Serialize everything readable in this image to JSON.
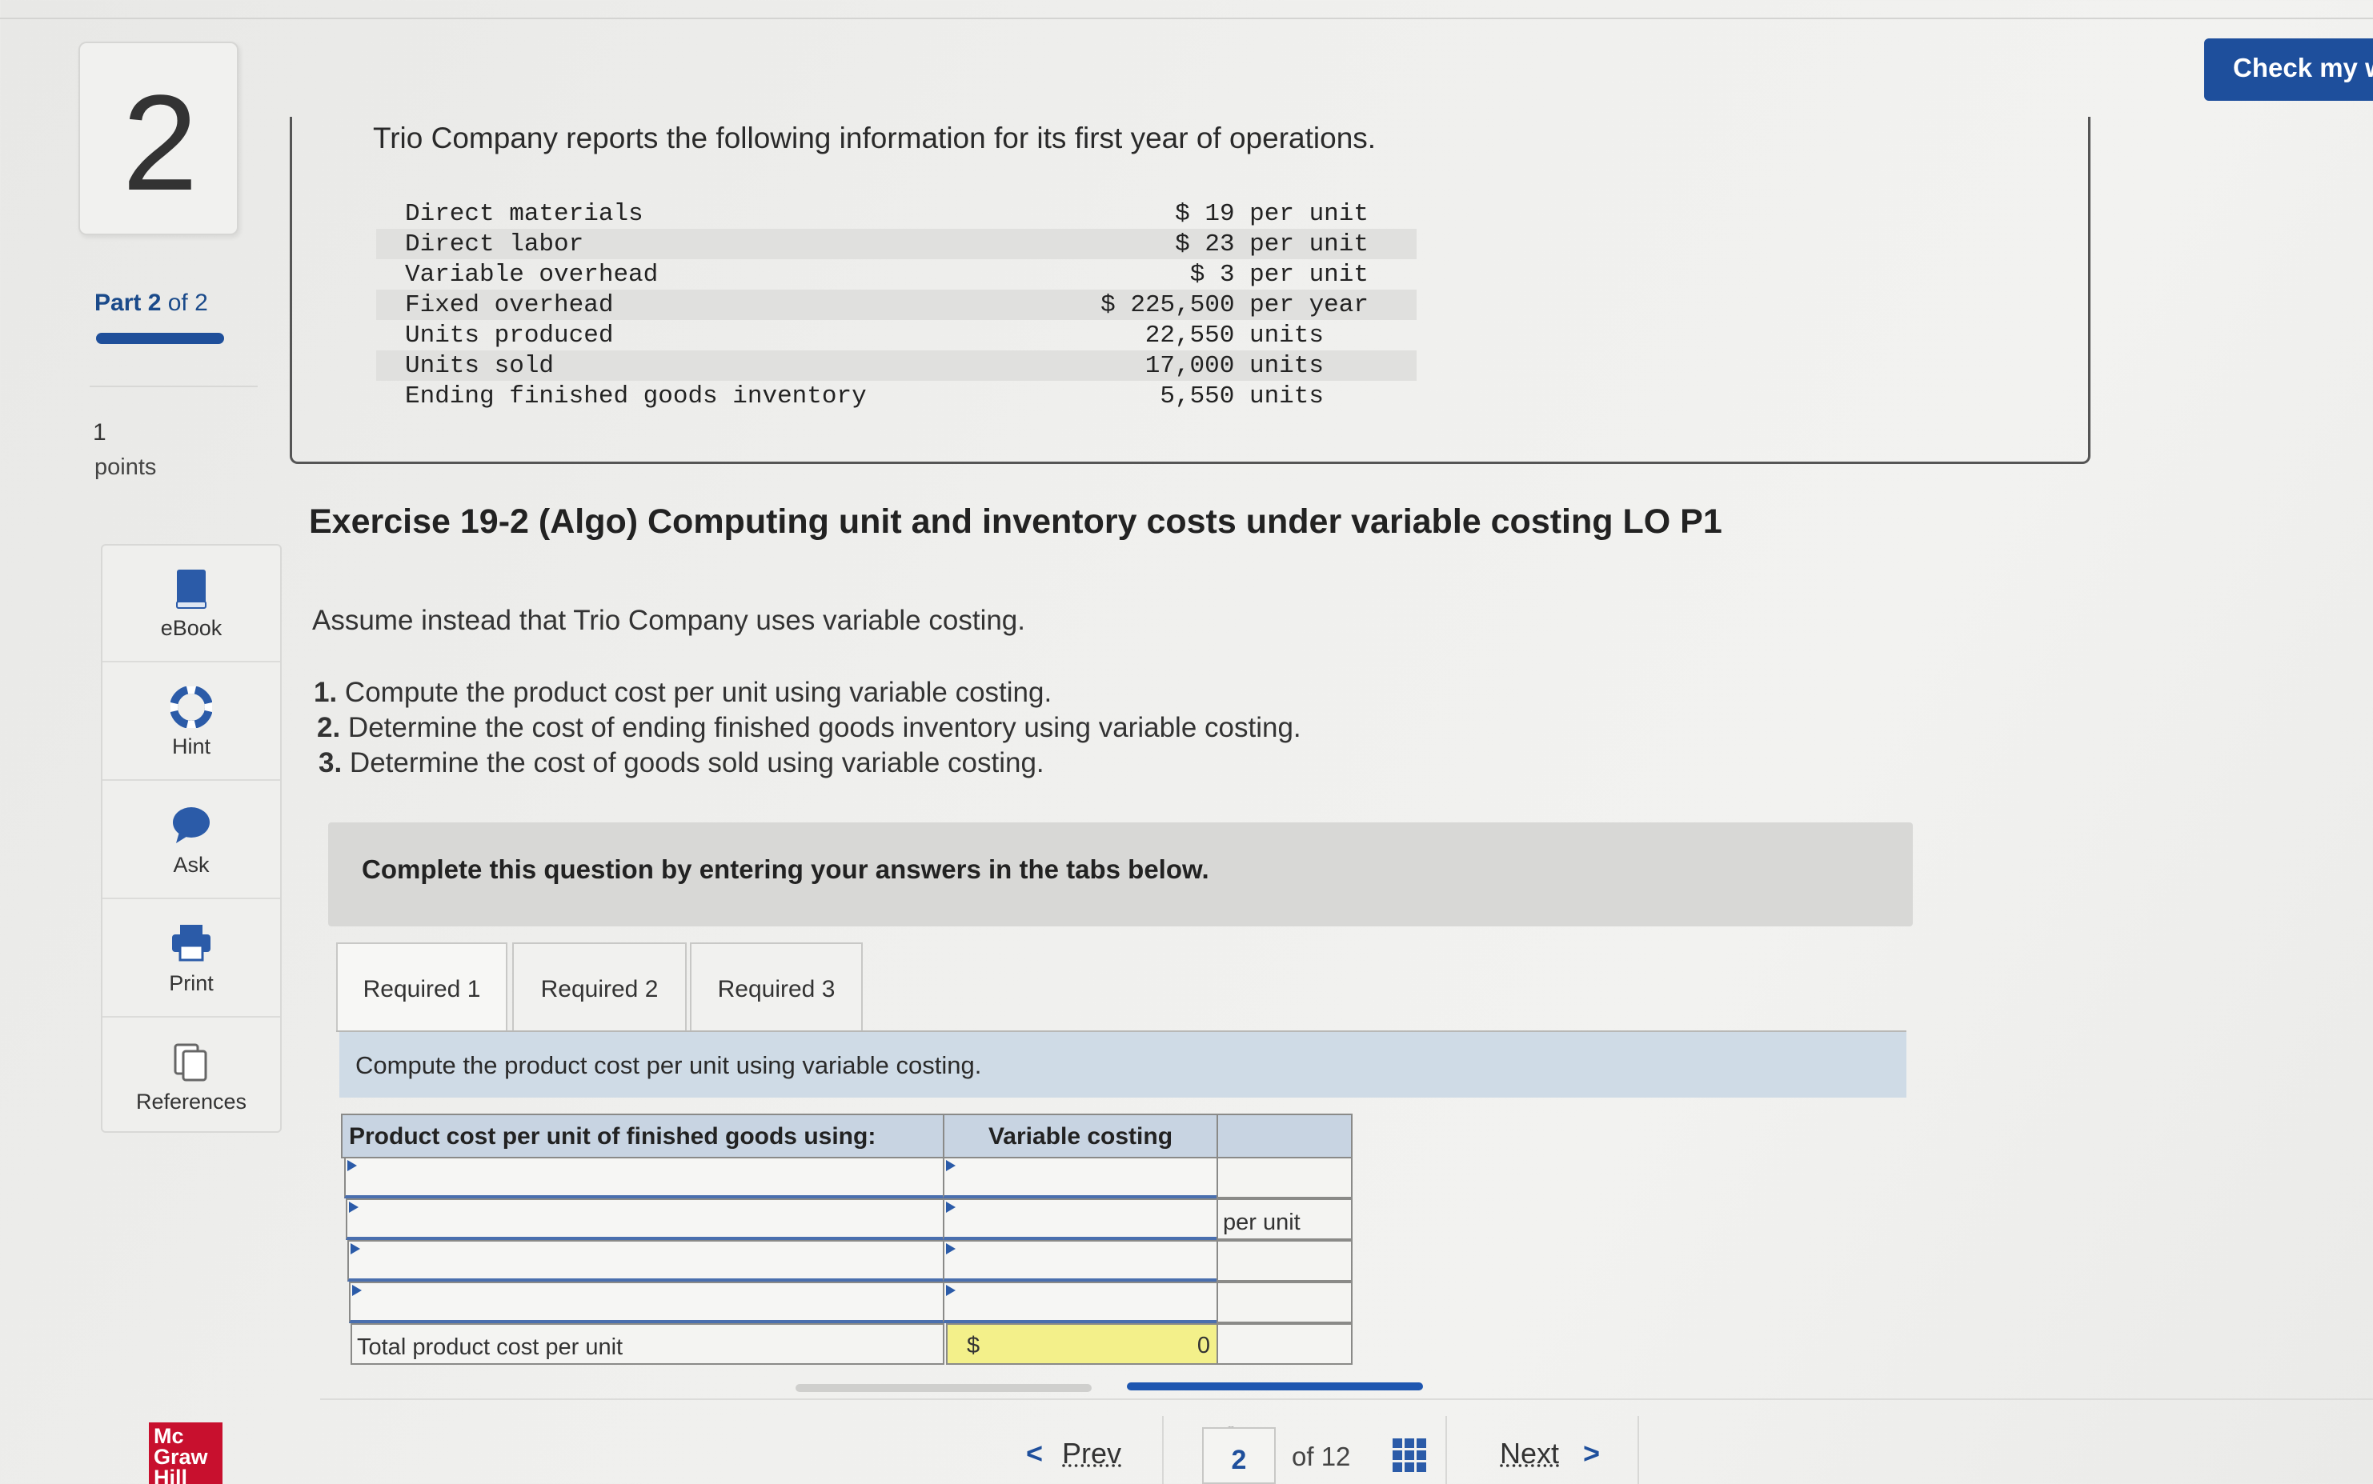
{
  "question": {
    "number": "2",
    "part_bold": "Part 2",
    "part_rest": "of 2",
    "points_value": "1",
    "points_label": "points"
  },
  "tools": [
    {
      "label": "eBook",
      "icon": "book-icon"
    },
    {
      "label": "Hint",
      "icon": "lifebuoy-icon"
    },
    {
      "label": "Ask",
      "icon": "chat-bubble-icon"
    },
    {
      "label": "Print",
      "icon": "printer-icon"
    },
    {
      "label": "References",
      "icon": "documents-icon"
    }
  ],
  "header": {
    "check_button": "Check my w"
  },
  "info": {
    "intro": "Trio Company reports the following information for its first year of operations.",
    "rows": [
      {
        "label": "Direct materials",
        "value": "$ 19 per unit"
      },
      {
        "label": "Direct labor",
        "value": "$ 23 per unit"
      },
      {
        "label": "Variable overhead",
        "value": "$ 3 per unit"
      },
      {
        "label": "Fixed overhead",
        "value": "$ 225,500 per year"
      },
      {
        "label": "Units produced",
        "value": "22,550 units"
      },
      {
        "label": "Units sold",
        "value": "17,000 units"
      },
      {
        "label": "Ending finished goods inventory",
        "value": "5,550 units"
      }
    ]
  },
  "exercise": {
    "title": "Exercise 19-2 (Algo) Computing unit and inventory costs under variable costing LO P1",
    "assume": "Assume instead that Trio Company uses variable costing.",
    "tasks": [
      {
        "num": "1.",
        "text": " Compute the product cost per unit using variable costing."
      },
      {
        "num": "2.",
        "text": " Determine the cost of ending finished goods inventory using variable costing."
      },
      {
        "num": "3.",
        "text": " Determine the cost of goods sold using variable costing."
      }
    ]
  },
  "banner": "Complete this question by entering your answers in the tabs below.",
  "tabs": [
    "Required 1",
    "Required 2",
    "Required 3"
  ],
  "instruction": "Compute the product cost per unit using variable costing.",
  "answer_table": {
    "header_label": "Product cost per unit of finished goods using:",
    "header_value": "Variable costing",
    "unit_label": "per unit",
    "total_label": "Total product cost per unit",
    "total_currency": "$",
    "total_value": "0"
  },
  "nav": {
    "prev": "Prev",
    "page": "2",
    "of_total": "of 12",
    "next": "Next"
  },
  "brand": {
    "logo_line1": "Mc",
    "logo_line2": "Graw",
    "logo_line3": "Hill"
  },
  "colors": {
    "accent": "#1e4f9c",
    "tab_panel": "#cfdbe6",
    "total_highlight": "#f3f08a",
    "logo": "#c8102e"
  }
}
